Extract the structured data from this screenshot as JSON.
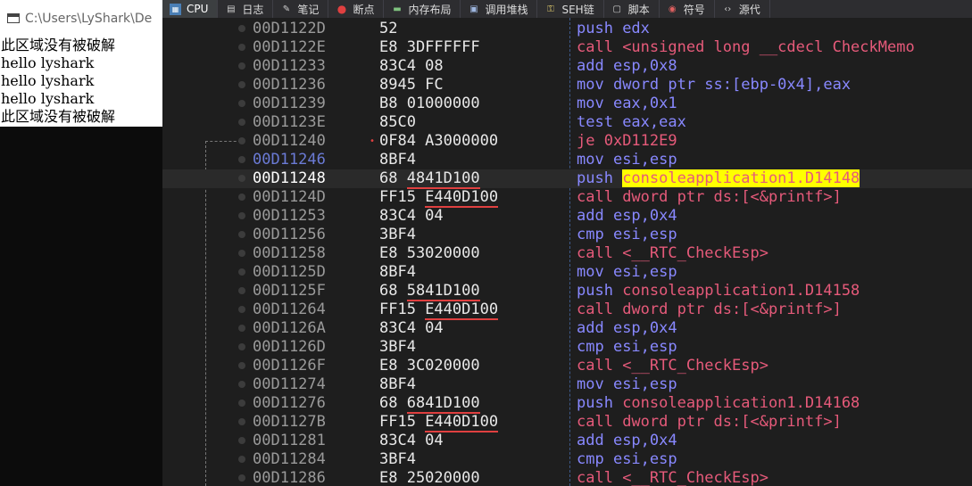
{
  "console": {
    "title": "C:\\Users\\LyShark\\De",
    "lines": [
      "此区域没有被破解",
      "hello lyshark",
      "hello lyshark",
      "hello lyshark",
      "此区域没有被破解"
    ]
  },
  "tabs": [
    {
      "label": "CPU",
      "icon": "cpu-icon",
      "active": true
    },
    {
      "label": "日志",
      "icon": "log-icon",
      "active": false
    },
    {
      "label": "笔记",
      "icon": "notes-icon",
      "active": false
    },
    {
      "label": "断点",
      "icon": "breakpoint-icon",
      "active": false
    },
    {
      "label": "内存布局",
      "icon": "memory-map-icon",
      "active": false
    },
    {
      "label": "调用堆栈",
      "icon": "call-stack-icon",
      "active": false
    },
    {
      "label": "SEH链",
      "icon": "seh-chain-icon",
      "active": false
    },
    {
      "label": "脚本",
      "icon": "script-icon",
      "active": false
    },
    {
      "label": "符号",
      "icon": "symbols-icon",
      "active": false
    },
    {
      "label": "源代",
      "icon": "source-icon",
      "active": false
    }
  ],
  "colors": {
    "background": "#1e1e1e",
    "address": "#9a9a9a",
    "eip_address": "#6b7bd6",
    "mnemonic": "#8888ff",
    "call_mnemonic": "#e65a7a",
    "highlight": "#ffff00",
    "bytes_underline": "#e04040"
  },
  "rows": [
    {
      "addr": "00D1122D",
      "bytes": "52",
      "mn": "push",
      "ops": "edx"
    },
    {
      "addr": "00D1122E",
      "bytes": "E8 3DFFFFFF",
      "mn": "call",
      "ops": "<unsigned long __cdecl CheckMemo"
    },
    {
      "addr": "00D11233",
      "bytes": "83C4 08",
      "mn": "add",
      "ops": "esp,0x8"
    },
    {
      "addr": "00D11236",
      "bytes": "8945 FC",
      "mn": "mov",
      "ops": "dword ptr ss:[ebp-0x4],eax"
    },
    {
      "addr": "00D11239",
      "bytes": "B8 01000000",
      "mn": "mov",
      "ops": "eax,0x1"
    },
    {
      "addr": "00D1123E",
      "bytes": "85C0",
      "mn": "test",
      "ops": "eax,eax"
    },
    {
      "addr": "00D11240",
      "bytes": "0F84 A3000000",
      "mn": "je",
      "ops": "0xD112E9"
    },
    {
      "addr": "00D11246",
      "bytes": "8BF4",
      "mn": "mov",
      "ops": "esi,esp"
    },
    {
      "addr": "00D11248",
      "bytes": "68 4841D100",
      "mn": "push",
      "ops": "consoleapplication1.D14148"
    },
    {
      "addr": "00D1124D",
      "bytes": "FF15 E440D100",
      "mn": "call",
      "ops": "dword ptr ds:[<&printf>]"
    },
    {
      "addr": "00D11253",
      "bytes": "83C4 04",
      "mn": "add",
      "ops": "esp,0x4"
    },
    {
      "addr": "00D11256",
      "bytes": "3BF4",
      "mn": "cmp",
      "ops": "esi,esp"
    },
    {
      "addr": "00D11258",
      "bytes": "E8 53020000",
      "mn": "call",
      "ops": "<__RTC_CheckEsp>"
    },
    {
      "addr": "00D1125D",
      "bytes": "8BF4",
      "mn": "mov",
      "ops": "esi,esp"
    },
    {
      "addr": "00D1125F",
      "bytes": "68 5841D100",
      "mn": "push",
      "ops": "consoleapplication1.D14158"
    },
    {
      "addr": "00D11264",
      "bytes": "FF15 E440D100",
      "mn": "call",
      "ops": "dword ptr ds:[<&printf>]"
    },
    {
      "addr": "00D1126A",
      "bytes": "83C4 04",
      "mn": "add",
      "ops": "esp,0x4"
    },
    {
      "addr": "00D1126D",
      "bytes": "3BF4",
      "mn": "cmp",
      "ops": "esi,esp"
    },
    {
      "addr": "00D1126F",
      "bytes": "E8 3C020000",
      "mn": "call",
      "ops": "<__RTC_CheckEsp>"
    },
    {
      "addr": "00D11274",
      "bytes": "8BF4",
      "mn": "mov",
      "ops": "esi,esp"
    },
    {
      "addr": "00D11276",
      "bytes": "68 6841D100",
      "mn": "push",
      "ops": "consoleapplication1.D14168"
    },
    {
      "addr": "00D1127B",
      "bytes": "FF15 E440D100",
      "mn": "call",
      "ops": "dword ptr ds:[<&printf>]"
    },
    {
      "addr": "00D11281",
      "bytes": "83C4 04",
      "mn": "add",
      "ops": "esp,0x4"
    },
    {
      "addr": "00D11284",
      "bytes": "3BF4",
      "mn": "cmp",
      "ops": "esi,esp"
    },
    {
      "addr": "00D11286",
      "bytes": "E8 25020000",
      "mn": "call",
      "ops": "<__RTC_CheckEsp>"
    }
  ],
  "selected_address": "00D11248",
  "eip_address": "00D11246",
  "highlighted_operand": "consoleapplication1.D14148"
}
